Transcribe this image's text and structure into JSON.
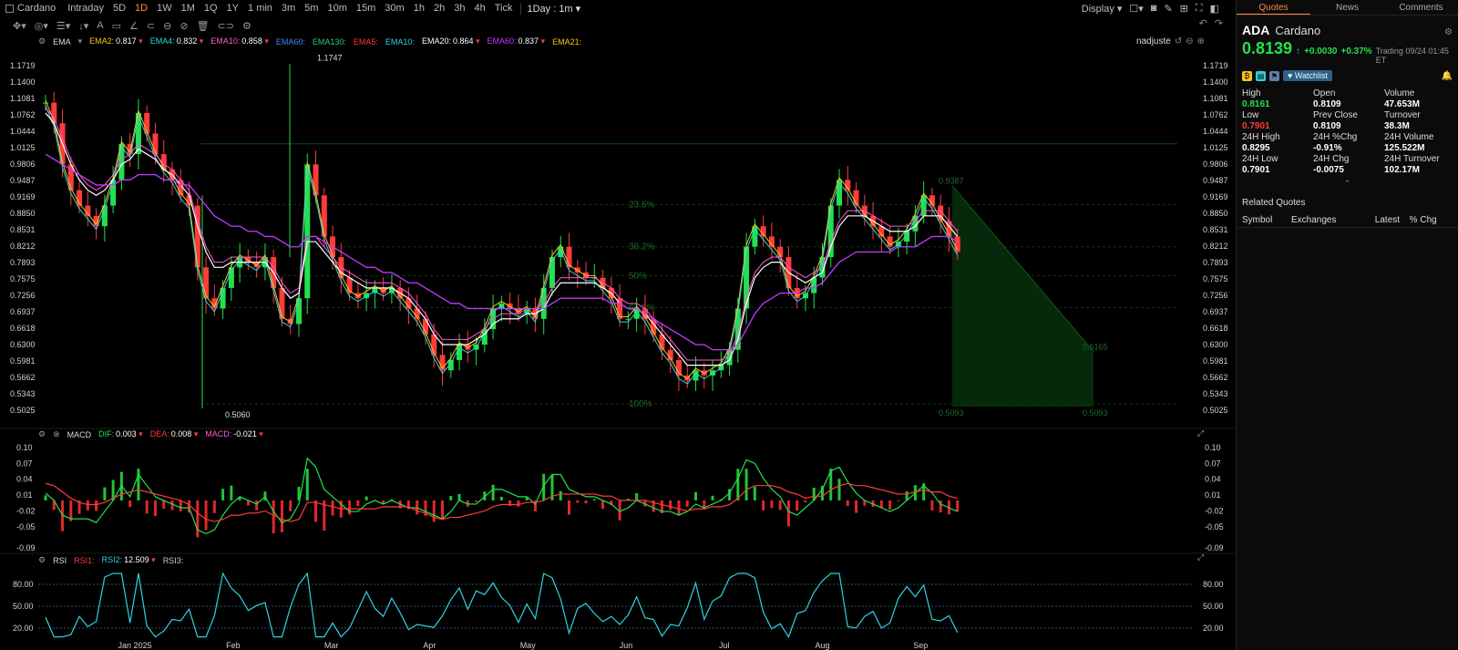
{
  "topbar": {
    "symbol": "Cardano",
    "timeframes": [
      "Intraday",
      "5D",
      "1D",
      "1W",
      "1M",
      "1Q",
      "1Y",
      "1 min",
      "3m",
      "5m",
      "10m",
      "15m",
      "30m",
      "1h",
      "2h",
      "3h",
      "4h",
      "Tick"
    ],
    "active_timeframe": "1D",
    "interval_select": "1Day : 1m",
    "display_label": "Display"
  },
  "legend_main": {
    "name": "EMA",
    "items": [
      {
        "label": "EMA2:",
        "value": "0.817",
        "color": "#f5c518"
      },
      {
        "label": "EMA4:",
        "value": "0.832",
        "color": "#2ed3e0"
      },
      {
        "label": "EMA10:",
        "value": "0.858",
        "color": "#ff5ad2"
      },
      {
        "label": "EMA60:",
        "value": "",
        "color": "#3a8cff"
      },
      {
        "label": "EMA130:",
        "value": "",
        "color": "#2ecc71"
      },
      {
        "label": "EMA5:",
        "value": "",
        "color": "#ff3b3b"
      },
      {
        "label": "EMA10:",
        "value": "",
        "color": "#2ed3e0"
      },
      {
        "label": "EMA20:",
        "value": "0.864",
        "color": "#ffffff"
      },
      {
        "label": "EMA60:",
        "value": "0.837",
        "color": "#c13bff"
      },
      {
        "label": "EMA21:",
        "value": "",
        "color": "#f5c518"
      }
    ],
    "adjust": "nadjuste"
  },
  "legend_macd": {
    "name": "MACD",
    "items": [
      {
        "label": "DIF:",
        "value": "0.003",
        "color": "#22e14c"
      },
      {
        "label": "DEA:",
        "value": "0.008",
        "color": "#ff3b3b"
      },
      {
        "label": "MACD:",
        "value": "-0.021",
        "color": "#ff5ad2"
      }
    ]
  },
  "legend_rsi": {
    "name": "RSI",
    "items": [
      {
        "label": "RSI1:",
        "value": "",
        "color": "#ff3b3b"
      },
      {
        "label": "RSI2:",
        "value": "12.509",
        "color": "#2ed3e0"
      },
      {
        "label": "RSI3:",
        "value": "",
        "color": "#cccccc"
      }
    ]
  },
  "chart_data": [
    {
      "type": "candlestick",
      "price_axis": [
        "1.1719",
        "1.1400",
        "1.1081",
        "1.0762",
        "1.0444",
        "1.0125",
        "0.9806",
        "0.9487",
        "0.9169",
        "0.8850",
        "0.8531",
        "0.8212",
        "0.7893",
        "0.7575",
        "0.7256",
        "0.6937",
        "0.6618",
        "0.6300",
        "0.5981",
        "0.5662",
        "0.5343",
        "0.5025"
      ],
      "ylim": [
        0.5025,
        1.1719
      ],
      "x_labels": [
        "Jan 2025",
        "Feb",
        "Mar",
        "Apr",
        "May",
        "Jun",
        "Jul",
        "Aug",
        "Sep"
      ],
      "close_series": [
        1.1,
        1.06,
        0.98,
        0.93,
        0.9,
        0.88,
        0.86,
        0.9,
        0.95,
        1.02,
        1.0,
        1.08,
        1.04,
        1.0,
        0.97,
        0.95,
        0.92,
        0.9,
        0.78,
        0.72,
        0.7,
        0.74,
        0.78,
        0.8,
        0.79,
        0.78,
        0.8,
        0.74,
        0.68,
        0.67,
        0.72,
        0.98,
        0.92,
        0.84,
        0.8,
        0.76,
        0.73,
        0.72,
        0.73,
        0.74,
        0.73,
        0.74,
        0.72,
        0.7,
        0.68,
        0.65,
        0.61,
        0.58,
        0.6,
        0.63,
        0.62,
        0.63,
        0.66,
        0.7,
        0.71,
        0.7,
        0.69,
        0.7,
        0.68,
        0.74,
        0.8,
        0.82,
        0.78,
        0.77,
        0.76,
        0.76,
        0.74,
        0.72,
        0.68,
        0.68,
        0.7,
        0.68,
        0.65,
        0.62,
        0.6,
        0.57,
        0.56,
        0.58,
        0.57,
        0.58,
        0.59,
        0.62,
        0.7,
        0.82,
        0.86,
        0.84,
        0.82,
        0.8,
        0.74,
        0.72,
        0.73,
        0.76,
        0.8,
        0.9,
        0.95,
        0.93,
        0.9,
        0.88,
        0.86,
        0.84,
        0.82,
        0.83,
        0.85,
        0.88,
        0.92,
        0.9,
        0.87,
        0.84,
        0.81
      ],
      "ema20_series": [
        1.08,
        1.06,
        1.02,
        0.98,
        0.95,
        0.93,
        0.92,
        0.93,
        0.95,
        0.98,
        0.99,
        1.01,
        1.0,
        0.99,
        0.97,
        0.96,
        0.94,
        0.92,
        0.86,
        0.81,
        0.78,
        0.78,
        0.79,
        0.79,
        0.79,
        0.79,
        0.79,
        0.77,
        0.74,
        0.72,
        0.73,
        0.83,
        0.83,
        0.81,
        0.79,
        0.77,
        0.76,
        0.75,
        0.74,
        0.74,
        0.74,
        0.74,
        0.73,
        0.72,
        0.7,
        0.68,
        0.65,
        0.63,
        0.63,
        0.63,
        0.63,
        0.64,
        0.65,
        0.67,
        0.68,
        0.68,
        0.68,
        0.69,
        0.69,
        0.7,
        0.73,
        0.75,
        0.75,
        0.75,
        0.75,
        0.75,
        0.74,
        0.73,
        0.71,
        0.7,
        0.7,
        0.69,
        0.67,
        0.65,
        0.63,
        0.61,
        0.59,
        0.59,
        0.59,
        0.59,
        0.59,
        0.6,
        0.64,
        0.71,
        0.76,
        0.78,
        0.79,
        0.79,
        0.77,
        0.76,
        0.75,
        0.76,
        0.77,
        0.82,
        0.86,
        0.88,
        0.88,
        0.88,
        0.87,
        0.86,
        0.85,
        0.85,
        0.85,
        0.86,
        0.88,
        0.88,
        0.88,
        0.86,
        0.84
      ],
      "ema60_series": [
        1.0,
        0.99,
        0.98,
        0.97,
        0.96,
        0.95,
        0.94,
        0.94,
        0.94,
        0.95,
        0.95,
        0.96,
        0.96,
        0.96,
        0.95,
        0.95,
        0.94,
        0.94,
        0.92,
        0.9,
        0.88,
        0.87,
        0.86,
        0.86,
        0.85,
        0.85,
        0.84,
        0.84,
        0.83,
        0.82,
        0.82,
        0.84,
        0.84,
        0.83,
        0.82,
        0.81,
        0.8,
        0.79,
        0.78,
        0.78,
        0.77,
        0.77,
        0.76,
        0.75,
        0.75,
        0.74,
        0.73,
        0.72,
        0.71,
        0.71,
        0.7,
        0.7,
        0.7,
        0.7,
        0.7,
        0.7,
        0.7,
        0.7,
        0.7,
        0.7,
        0.71,
        0.72,
        0.72,
        0.72,
        0.72,
        0.72,
        0.72,
        0.71,
        0.71,
        0.7,
        0.7,
        0.69,
        0.68,
        0.67,
        0.66,
        0.65,
        0.64,
        0.63,
        0.63,
        0.62,
        0.62,
        0.62,
        0.63,
        0.66,
        0.69,
        0.71,
        0.72,
        0.73,
        0.73,
        0.73,
        0.74,
        0.74,
        0.75,
        0.77,
        0.79,
        0.8,
        0.81,
        0.81,
        0.81,
        0.81,
        0.81,
        0.82,
        0.82,
        0.82,
        0.83,
        0.84,
        0.84,
        0.84,
        0.83
      ],
      "annotations": [
        {
          "label": "1.1747",
          "value": 1.1747
        },
        {
          "label": "0.5060",
          "value": 0.506
        },
        {
          "label": "0.9387",
          "value": 0.9387
        },
        {
          "label": "0.6165",
          "value": 0.6165
        },
        {
          "label": "0.5093",
          "value": 0.5093
        }
      ],
      "fib_levels": [
        {
          "label": "23.6%",
          "value": 0.902
        },
        {
          "label": "38.2%",
          "value": 0.82
        },
        {
          "label": "50%",
          "value": 0.764
        },
        {
          "label": "61.8%",
          "value": 0.702
        },
        {
          "label": "100%",
          "value": 0.515
        }
      ]
    },
    {
      "type": "bar+line",
      "name": "MACD",
      "y_axis": [
        "0.10",
        "0.07",
        "0.04",
        "0.01",
        "-0.02",
        "-0.05",
        "-0.09"
      ],
      "ylim": [
        -0.09,
        0.1
      ]
    },
    {
      "type": "line",
      "name": "RSI",
      "y_axis": [
        "80.00",
        "50.00",
        "20.00"
      ],
      "ylim": [
        0,
        100
      ]
    }
  ],
  "panel": {
    "tabs": [
      "Quotes",
      "News",
      "Comments"
    ],
    "active_tab": "Quotes",
    "code": "ADA",
    "name": "Cardano",
    "price": "0.8139",
    "arrow": "↑",
    "change": "+0.0030",
    "change_pct": "+0.37%",
    "trading": "Trading 09/24 01:45 ET",
    "watchlist": "Watchlist",
    "stats": [
      {
        "k": "High",
        "v": "0.8161",
        "cls": "up"
      },
      {
        "k": "Open",
        "v": "0.8109",
        "cls": ""
      },
      {
        "k": "Volume",
        "v": "47.653M",
        "cls": ""
      },
      {
        "k": "Low",
        "v": "0.7901",
        "cls": "dn"
      },
      {
        "k": "Prev Close",
        "v": "0.8109",
        "cls": ""
      },
      {
        "k": "Turnover",
        "v": "38.3M",
        "cls": ""
      },
      {
        "k": "24H High",
        "v": "0.8295",
        "cls": ""
      },
      {
        "k": "24H %Chg",
        "v": "-0.91%",
        "cls": ""
      },
      {
        "k": "24H Volume",
        "v": "125.522M",
        "cls": ""
      },
      {
        "k": "24H Low",
        "v": "0.7901",
        "cls": ""
      },
      {
        "k": "24H Chg",
        "v": "-0.0075",
        "cls": ""
      },
      {
        "k": "24H Turnover",
        "v": "102.17M",
        "cls": ""
      }
    ],
    "related_title": "Related Quotes",
    "related_cols": [
      "Symbol",
      "Exchanges",
      "Latest",
      "% Chg"
    ]
  }
}
